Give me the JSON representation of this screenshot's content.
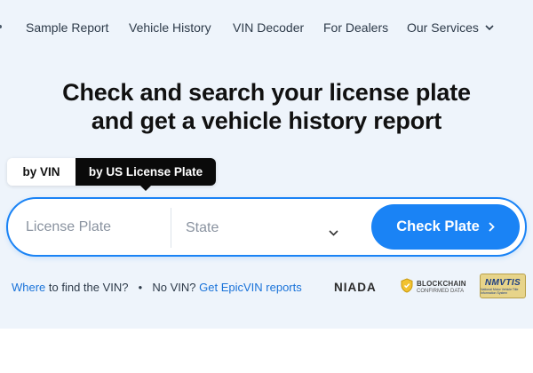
{
  "nav": {
    "items": [
      "Sample Report",
      "Vehicle History",
      "VIN Decoder",
      "For Dealers",
      "Our Services"
    ]
  },
  "headline": {
    "line1": "Check and search your license plate",
    "line2": "and get a vehicle history report"
  },
  "tabs": {
    "vin": "by VIN",
    "plate": "by US License Plate",
    "active": "plate"
  },
  "search": {
    "plate_placeholder": "License Plate",
    "state_placeholder": "State",
    "button_label": "Check Plate"
  },
  "links": {
    "where": "Where",
    "where_rest": " to find the VIN?",
    "sep": "●",
    "no_vin": "No VIN?",
    "epic": "Get EpicVIN reports"
  },
  "badges": {
    "niada": "NIADA",
    "blockchain_1": "BLOCKCHAIN",
    "blockchain_2": "CONFIRMED DATA",
    "nmvtis": "NMVTIS",
    "nmvtis_sub": "National Motor Vehicle Title Information System"
  },
  "colors": {
    "accent": "#1a83f5",
    "background": "#eef4fb",
    "dark": "#0a0a0a"
  },
  "icons": [
    "chevron-down-icon",
    "chevron-right-icon",
    "shield-icon"
  ]
}
